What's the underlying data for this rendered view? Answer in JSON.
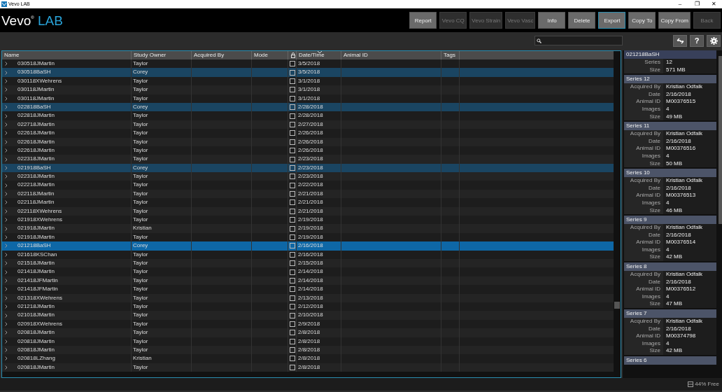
{
  "window": {
    "title": "Vevo LAB",
    "controls": [
      "–",
      "❐",
      "✕"
    ]
  },
  "logo": {
    "main": "Vevo",
    "mark": "®",
    "accent": "LAB"
  },
  "toolbar": [
    {
      "label": "Report",
      "disabled": false,
      "focused": false
    },
    {
      "label": "Vevo CQ",
      "disabled": true,
      "focused": false
    },
    {
      "label": "Vevo Strain",
      "disabled": true,
      "focused": false
    },
    {
      "label": "Vevo Vasc",
      "disabled": true,
      "focused": false
    },
    {
      "label": "Info",
      "disabled": false,
      "focused": false
    },
    {
      "label": "Delete",
      "disabled": false,
      "focused": false
    },
    {
      "label": "Export",
      "disabled": false,
      "focused": true
    },
    {
      "label": "Copy To",
      "disabled": false,
      "focused": false
    },
    {
      "label": "Copy From",
      "disabled": false,
      "focused": false
    },
    {
      "label": "Back",
      "disabled": true,
      "focused": false
    }
  ],
  "help_label": "?",
  "table": {
    "columns": [
      {
        "kind": "text",
        "label": "Name"
      },
      {
        "kind": "text",
        "label": "Study Owner"
      },
      {
        "kind": "text",
        "label": "Acquired By"
      },
      {
        "kind": "text",
        "label": "Mode"
      },
      {
        "kind": "lock"
      },
      {
        "kind": "text",
        "label": "Date/Time",
        "sorted": true
      },
      {
        "kind": "text",
        "label": "Animal ID"
      },
      {
        "kind": "text",
        "label": "Tags"
      }
    ],
    "rows": [
      {
        "name": "030518JMartin",
        "owner": "Taylor",
        "date": "3/5/2018",
        "checked": false,
        "selected": false,
        "current": false
      },
      {
        "name": "030518BaSH",
        "owner": "Corey",
        "date": "3/5/2018",
        "checked": false,
        "selected": true,
        "current": false
      },
      {
        "name": "030118XWehrens",
        "owner": "Taylor",
        "date": "3/1/2018",
        "checked": false,
        "selected": false,
        "current": false
      },
      {
        "name": "030118JMartin",
        "owner": "Taylor",
        "date": "3/1/2018",
        "checked": false,
        "selected": false,
        "current": false
      },
      {
        "name": "030118JMartin",
        "owner": "Taylor",
        "date": "3/1/2018",
        "checked": false,
        "selected": false,
        "current": false
      },
      {
        "name": "022818BaSH",
        "owner": "Corey",
        "date": "2/28/2018",
        "checked": false,
        "selected": true,
        "current": false
      },
      {
        "name": "022818JMartin",
        "owner": "Taylor",
        "date": "2/28/2018",
        "checked": false,
        "selected": false,
        "current": false
      },
      {
        "name": "022718JMartin",
        "owner": "Taylor",
        "date": "2/27/2018",
        "checked": false,
        "selected": false,
        "current": false
      },
      {
        "name": "022618JMartin",
        "owner": "Taylor",
        "date": "2/26/2018",
        "checked": false,
        "selected": false,
        "current": false
      },
      {
        "name": "022618JMartin",
        "owner": "Taylor",
        "date": "2/26/2018",
        "checked": false,
        "selected": false,
        "current": false
      },
      {
        "name": "022618JMartin",
        "owner": "Taylor",
        "date": "2/26/2018",
        "checked": false,
        "selected": false,
        "current": false
      },
      {
        "name": "022318JMartin",
        "owner": "Taylor",
        "date": "2/23/2018",
        "checked": false,
        "selected": false,
        "current": false
      },
      {
        "name": "021918BaSH",
        "owner": "Corey",
        "date": "2/23/2018",
        "checked": false,
        "selected": true,
        "current": false
      },
      {
        "name": "022318JMartin",
        "owner": "Taylor",
        "date": "2/23/2018",
        "checked": false,
        "selected": false,
        "current": false
      },
      {
        "name": "022218JMartin",
        "owner": "Taylor",
        "date": "2/22/2018",
        "checked": false,
        "selected": false,
        "current": false
      },
      {
        "name": "022118JMartin",
        "owner": "Taylor",
        "date": "2/21/2018",
        "checked": false,
        "selected": false,
        "current": false
      },
      {
        "name": "022118JMartin",
        "owner": "Taylor",
        "date": "2/21/2018",
        "checked": false,
        "selected": false,
        "current": false
      },
      {
        "name": "022118XWehrens",
        "owner": "Taylor",
        "date": "2/21/2018",
        "checked": false,
        "selected": false,
        "current": false
      },
      {
        "name": "021918XWehrens",
        "owner": "Taylor",
        "date": "2/19/2018",
        "checked": false,
        "selected": false,
        "current": false
      },
      {
        "name": "021918JMartin",
        "owner": "Kristian",
        "date": "2/19/2018",
        "checked": false,
        "selected": false,
        "current": false
      },
      {
        "name": "021918JMartin",
        "owner": "Taylor",
        "date": "2/19/2018",
        "checked": false,
        "selected": false,
        "current": false
      },
      {
        "name": "021218BaSH",
        "owner": "Corey",
        "date": "2/16/2018",
        "checked": false,
        "selected": true,
        "current": true
      },
      {
        "name": "021618KSChan",
        "owner": "Taylor",
        "date": "2/16/2018",
        "checked": false,
        "selected": false,
        "current": false
      },
      {
        "name": "021518JMartin",
        "owner": "Taylor",
        "date": "2/15/2018",
        "checked": false,
        "selected": false,
        "current": false
      },
      {
        "name": "021418JMartin",
        "owner": "Taylor",
        "date": "2/14/2018",
        "checked": false,
        "selected": false,
        "current": false
      },
      {
        "name": "021418JFMartin",
        "owner": "Taylor",
        "date": "2/14/2018",
        "checked": false,
        "selected": false,
        "current": false
      },
      {
        "name": "021418JFMartin",
        "owner": "Taylor",
        "date": "2/14/2018",
        "checked": false,
        "selected": false,
        "current": false
      },
      {
        "name": "021318XWehrens",
        "owner": "Taylor",
        "date": "2/13/2018",
        "checked": false,
        "selected": false,
        "current": false
      },
      {
        "name": "021218JMartin",
        "owner": "Taylor",
        "date": "2/12/2018",
        "checked": false,
        "selected": false,
        "current": false
      },
      {
        "name": "021018JMartin",
        "owner": "Taylor",
        "date": "2/10/2018",
        "checked": false,
        "selected": false,
        "current": false
      },
      {
        "name": "020918XWehrens",
        "owner": "Taylor",
        "date": "2/9/2018",
        "checked": false,
        "selected": false,
        "current": false
      },
      {
        "name": "020818JMartin",
        "owner": "Taylor",
        "date": "2/8/2018",
        "checked": false,
        "selected": false,
        "current": false
      },
      {
        "name": "020818JMartin",
        "owner": "Taylor",
        "date": "2/8/2018",
        "checked": false,
        "selected": false,
        "current": false
      },
      {
        "name": "020818JMartin",
        "owner": "Taylor",
        "date": "2/8/2018",
        "checked": false,
        "selected": false,
        "current": false
      },
      {
        "name": "020818LZhang",
        "owner": "Kristian",
        "date": "2/8/2018",
        "checked": false,
        "selected": false,
        "current": false
      },
      {
        "name": "020818JMartin",
        "owner": "Taylor",
        "date": "2/8/2018",
        "checked": false,
        "selected": false,
        "current": false
      }
    ]
  },
  "details": {
    "title": "021218BaSH",
    "summary": [
      {
        "label": "Series",
        "value": "12"
      },
      {
        "label": "Size",
        "value": "571 MB"
      }
    ],
    "series": [
      {
        "title": "Series 12",
        "fields": [
          {
            "label": "Acquired By",
            "value": "Kristian Odfalk"
          },
          {
            "label": "Date",
            "value": "2/16/2018"
          },
          {
            "label": "Animal ID",
            "value": "M00376515"
          },
          {
            "label": "Images",
            "value": "4"
          },
          {
            "label": "Size",
            "value": "49 MB"
          }
        ]
      },
      {
        "title": "Series 11",
        "fields": [
          {
            "label": "Acquired By",
            "value": "Kristian Odfalk"
          },
          {
            "label": "Date",
            "value": "2/16/2018"
          },
          {
            "label": "Animal ID",
            "value": "M00376516"
          },
          {
            "label": "Images",
            "value": "4"
          },
          {
            "label": "Size",
            "value": "50 MB"
          }
        ]
      },
      {
        "title": "Series 10",
        "fields": [
          {
            "label": "Acquired By",
            "value": "Kristian Odfalk"
          },
          {
            "label": "Date",
            "value": "2/16/2018"
          },
          {
            "label": "Animal ID",
            "value": "M00376513"
          },
          {
            "label": "Images",
            "value": "4"
          },
          {
            "label": "Size",
            "value": "46 MB"
          }
        ]
      },
      {
        "title": "Series 9",
        "fields": [
          {
            "label": "Acquired By",
            "value": "Kristian Odfalk"
          },
          {
            "label": "Date",
            "value": "2/16/2018"
          },
          {
            "label": "Animal ID",
            "value": "M00376514"
          },
          {
            "label": "Images",
            "value": "4"
          },
          {
            "label": "Size",
            "value": "42 MB"
          }
        ]
      },
      {
        "title": "Series 8",
        "fields": [
          {
            "label": "Acquired By",
            "value": "Kristian Odfalk"
          },
          {
            "label": "Date",
            "value": "2/16/2018"
          },
          {
            "label": "Animal ID",
            "value": "M00376512"
          },
          {
            "label": "Images",
            "value": "4"
          },
          {
            "label": "Size",
            "value": "47 MB"
          }
        ]
      },
      {
        "title": "Series 7",
        "fields": [
          {
            "label": "Acquired By",
            "value": "Kristian Odfalk"
          },
          {
            "label": "Date",
            "value": "2/16/2018"
          },
          {
            "label": "Animal ID",
            "value": "M00374798"
          },
          {
            "label": "Images",
            "value": "4"
          },
          {
            "label": "Size",
            "value": "42 MB"
          }
        ]
      },
      {
        "title": "Series 6"
      }
    ]
  },
  "status": {
    "disk_free": "44% Free"
  }
}
